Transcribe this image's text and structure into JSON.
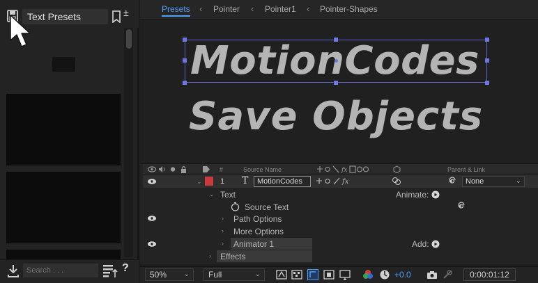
{
  "left_panel": {
    "preset_label": "Text Presets",
    "search_placeholder": "Search . . .",
    "help_glyph": "?",
    "add_glyph": "±"
  },
  "comp_tabs": {
    "items": [
      "Presets",
      "Pointer",
      "Pointer1",
      "Pointer-Shapes"
    ],
    "separator": "‹",
    "accent": "#4ea1ff"
  },
  "viewer": {
    "line1": "MotionCodes",
    "line2": "Save Objects",
    "text_color": "#b4b4b4",
    "selection_color": "#5b63c2"
  },
  "timeline": {
    "headers": {
      "number": "#",
      "source_name": "Source Name",
      "parent_link": "Parent & Link"
    },
    "layer": {
      "index": "1",
      "type_glyph": "T",
      "name": "MotionCodes",
      "label_color": "#c93a3a",
      "parent": "None"
    },
    "properties": {
      "text": "Text",
      "animate_label": "Animate:",
      "source_text": "Source Text",
      "path_options": "Path Options",
      "more_options": "More Options",
      "animator": "Animator 1",
      "add_label": "Add:",
      "effects": "Effects"
    }
  },
  "viewer_bar": {
    "zoom": "50%",
    "resolution": "Full",
    "exposure": "+0.0",
    "timecode": "0:00:01:12"
  },
  "icons": {
    "save": "save-icon",
    "bookmark": "bookmark-icon",
    "cursor": "mouse-pointer-icon",
    "import": "import-icon",
    "sort": "sort-icon",
    "eye": "eye-icon",
    "stopwatch": "stopwatch-icon",
    "spiral": "pick-whip-icon",
    "play": "play-circle-icon",
    "camera": "snapshot-icon",
    "color_wheel": "color-channels-icon"
  }
}
